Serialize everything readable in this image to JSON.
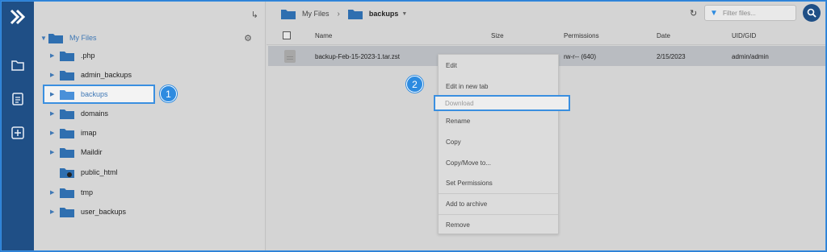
{
  "sidebar_rail": {
    "icons": [
      "brand-logo-icon",
      "folder-icon",
      "document-icon",
      "add-box-icon"
    ]
  },
  "tree": {
    "root_label": "My Files",
    "items": [
      {
        "label": ".php"
      },
      {
        "label": "admin_backups"
      },
      {
        "label": "backups"
      },
      {
        "label": "domains"
      },
      {
        "label": "imap"
      },
      {
        "label": "Maildir"
      },
      {
        "label": "public_html"
      },
      {
        "label": "tmp"
      },
      {
        "label": "user_backups"
      }
    ],
    "selected": "backups"
  },
  "breadcrumb": {
    "root": "My Files",
    "current": "backups"
  },
  "toolbar": {
    "filter_placeholder": "Filter files..."
  },
  "table": {
    "columns": [
      "Name",
      "Size",
      "Permissions",
      "Date",
      "UID/GID"
    ],
    "rows": [
      {
        "name": "backup-Feb-15-2023-1.tar.zst",
        "size": "",
        "permissions": "rw-r-- (640)",
        "date": "2/15/2023",
        "uid_gid": "admin/admin"
      }
    ]
  },
  "context_menu": {
    "items": [
      "Edit",
      "Edit in new tab",
      "Download",
      "Rename",
      "Copy",
      "Copy/Move to...",
      "Set Permissions",
      "Add to archive",
      "Remove"
    ],
    "highlighted": "Download"
  },
  "callouts": {
    "step1": "1",
    "step2": "2"
  },
  "colors": {
    "accent": "#2d8be0",
    "rail": "#1f4f86",
    "folder": "#2f6fb0"
  }
}
